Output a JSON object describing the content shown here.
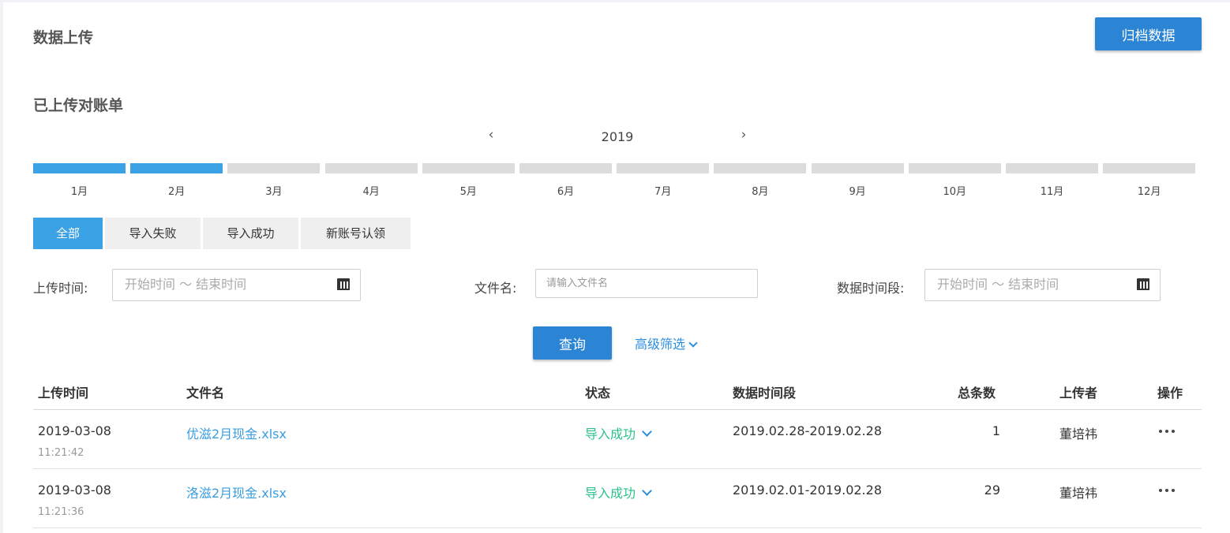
{
  "header": {
    "title": "数据上传",
    "archive_button": "归档数据"
  },
  "section": {
    "title": "已上传对账单"
  },
  "year_nav": {
    "year": "2019",
    "prev_icon": "chevron-left-icon",
    "next_icon": "chevron-right-icon",
    "prev": "‹",
    "next": "›"
  },
  "months": [
    {
      "label": "1月",
      "uploaded": true
    },
    {
      "label": "2月",
      "uploaded": true
    },
    {
      "label": "3月",
      "uploaded": false
    },
    {
      "label": "4月",
      "uploaded": false
    },
    {
      "label": "5月",
      "uploaded": false
    },
    {
      "label": "6月",
      "uploaded": false
    },
    {
      "label": "7月",
      "uploaded": false
    },
    {
      "label": "8月",
      "uploaded": false
    },
    {
      "label": "9月",
      "uploaded": false
    },
    {
      "label": "10月",
      "uploaded": false
    },
    {
      "label": "11月",
      "uploaded": false
    },
    {
      "label": "12月",
      "uploaded": false
    }
  ],
  "tabs": [
    {
      "label": "全部",
      "active": true
    },
    {
      "label": "导入失败",
      "active": false
    },
    {
      "label": "导入成功",
      "active": false
    },
    {
      "label": "新账号认领",
      "active": false
    }
  ],
  "filters": {
    "upload_time": {
      "label": "上传时间:",
      "placeholder": "开始时间 ～ 结束时间"
    },
    "file_name": {
      "label": "文件名:",
      "placeholder": "请输入文件名",
      "value": ""
    },
    "data_period": {
      "label": "数据时间段:",
      "placeholder": "开始时间 ～ 结束时间"
    }
  },
  "actions": {
    "query": "查询",
    "advanced_filter": "高级筛选"
  },
  "table": {
    "columns": [
      "上传时间",
      "文件名",
      "状态",
      "数据时间段",
      "总条数",
      "上传者",
      "操作"
    ],
    "rows": [
      {
        "date": "2019-03-08",
        "time": "11:21:42",
        "file": "优滋2月现金.xlsx",
        "status": "导入成功",
        "period": "2019.02.28-2019.02.28",
        "count": "1",
        "uploader": "董培祎"
      },
      {
        "date": "2019-03-08",
        "time": "11:21:36",
        "file": "洛滋2月现金.xlsx",
        "status": "导入成功",
        "period": "2019.02.01-2019.02.28",
        "count": "29",
        "uploader": "董培祎"
      }
    ]
  },
  "colors": {
    "primary": "#2b85d4",
    "accent": "#3ba2e6",
    "success": "#2cc28a",
    "link": "#3a9de0"
  }
}
